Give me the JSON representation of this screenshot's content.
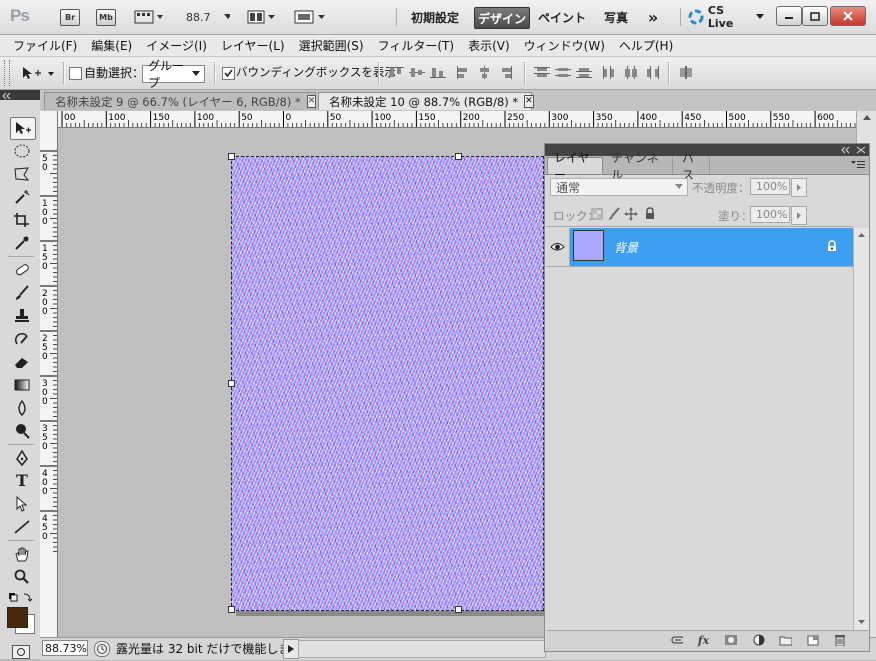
{
  "appbar": {
    "logo": "Ps",
    "bridge_badge": "Br",
    "minibridge_badge": "Mb",
    "zoom": "88.7",
    "workspaces": [
      "初期設定",
      "デザイン",
      "ペイント",
      "写真"
    ],
    "more": "»",
    "cslive": "CS Live"
  },
  "menu": [
    "ファイル(F)",
    "編集(E)",
    "イメージ(I)",
    "レイヤー(L)",
    "選択範囲(S)",
    "フィルター(T)",
    "表示(V)",
    "ウィンドウ(W)",
    "ヘルプ(H)"
  ],
  "options": {
    "auto_select_label": "自動選択：",
    "auto_select_value": "グループ",
    "bounding_box_label": "バウンディングボックスを表示"
  },
  "tabs": [
    {
      "label": "名称未設定 9 @ 66.7% (レイヤー 6, RGB/8) *",
      "close": "✕"
    },
    {
      "label": "名称未設定 10 @ 88.7% (RGB/8) *",
      "close": "✕"
    }
  ],
  "ruler_top": [
    "00",
    "100",
    "150",
    "100",
    "50",
    "0",
    "50",
    "100",
    "150",
    "200",
    "250",
    "300",
    "350",
    "400",
    "450",
    "500",
    "550",
    "600",
    "650"
  ],
  "ruler_left": [
    "5\n0",
    "1\n0\n0",
    "1\n5\n0",
    "2\n0\n0",
    "2\n5\n0",
    "3\n0\n0",
    "3\n5\n0",
    "4\n0\n0",
    "4\n5\n0"
  ],
  "layers_panel": {
    "tabs": [
      "レイヤー",
      "チャンネル",
      "パス"
    ],
    "blend_mode": "通常",
    "opacity_label": "不透明度：",
    "opacity_value": "100%",
    "lock_label": "ロック：",
    "fill_label": "塗り：",
    "fill_value": "100%",
    "layer_name": "背景"
  },
  "status": {
    "zoom": "88.73%",
    "message": "露光量は 32 bit だけで機能します"
  }
}
